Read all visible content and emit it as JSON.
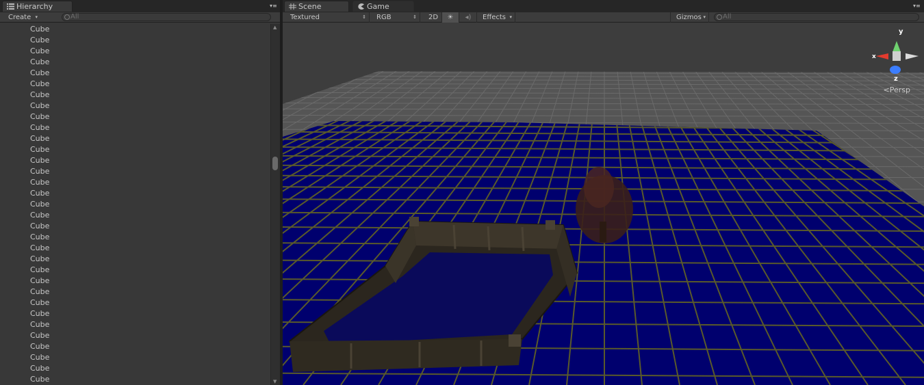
{
  "hierarchy": {
    "tab_label": "Hierarchy",
    "create_label": "Create",
    "search_placeholder": "All",
    "items": [
      "Cube",
      "Cube",
      "Cube",
      "Cube",
      "Cube",
      "Cube",
      "Cube",
      "Cube",
      "Cube",
      "Cube",
      "Cube",
      "Cube",
      "Cube",
      "Cube",
      "Cube",
      "Cube",
      "Cube",
      "Cube",
      "Cube",
      "Cube",
      "Cube",
      "Cube",
      "Cube",
      "Cube",
      "Cube",
      "Cube",
      "Cube",
      "Cube",
      "Cube",
      "Cube",
      "Cube",
      "Cube",
      "Cube"
    ]
  },
  "scene": {
    "tabs": [
      {
        "label": "Scene",
        "icon": "grid-icon",
        "active": true
      },
      {
        "label": "Game",
        "icon": "pacman-icon",
        "active": false
      }
    ],
    "toolbar": {
      "draw_mode": "Textured",
      "render_mode": "RGB",
      "toggle_2d": "2D",
      "lighting_icon": "sun-icon",
      "audio_icon": "speaker-icon",
      "effects_label": "Effects",
      "gizmos_label": "Gizmos",
      "search_placeholder": "All"
    },
    "gizmo": {
      "y": "y",
      "x": "x",
      "z": "z",
      "projection": "Persp"
    },
    "colors": {
      "water": "#00006e",
      "grid_line": "#5a5a2a",
      "sky": "#3d3d3d"
    }
  }
}
